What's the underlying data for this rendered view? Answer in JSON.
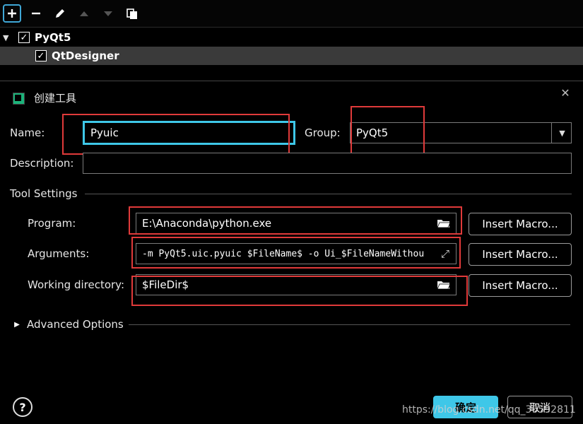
{
  "toolbar": {
    "add_icon": "plus-icon",
    "remove_icon": "minus-icon",
    "edit_icon": "pencil-icon",
    "up_icon": "arrow-up-icon",
    "down_icon": "arrow-down-icon",
    "copy_icon": "copy-icon"
  },
  "tree": {
    "group": {
      "label": "PyQt5",
      "checked": true
    },
    "item": {
      "label": "QtDesigner",
      "checked": true
    }
  },
  "dialog": {
    "title": "创建工具",
    "name_label": "Name:",
    "name_value": "Pyuic",
    "group_label": "Group:",
    "group_value": "PyQt5",
    "description_label": "Description:",
    "description_value": "",
    "tool_settings_label": "Tool Settings",
    "program_label": "Program:",
    "program_value": "E:\\Anaconda\\python.exe",
    "arguments_label": "Arguments:",
    "arguments_value": "-m PyQt5.uic.pyuic $FileName$  -o Ui_$FileNameWithou",
    "working_dir_label": "Working directory:",
    "working_dir_value": "$FileDir$",
    "insert_macro_label": "Insert Macro...",
    "advanced_options_label": "Advanced Options",
    "ok_label": "确定",
    "cancel_label": "取消",
    "help_label": "?"
  },
  "watermark": "https://blog.csdn.net/qq_36592811",
  "colors": {
    "focus": "#3ec7e8",
    "annotation": "#e03a3a",
    "primary_button": "#3ec7e8"
  }
}
